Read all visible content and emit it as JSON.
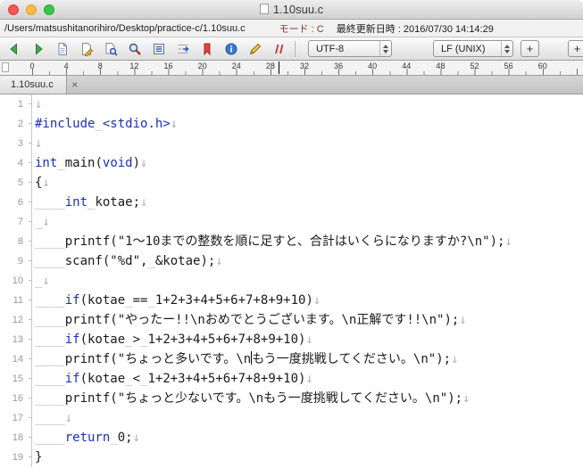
{
  "window": {
    "title": "1.10suu.c"
  },
  "info_bar": {
    "path": "/Users/matsushitanorihiro/Desktop/practice-c/1.10suu.c",
    "mode": "モード : C",
    "last_modified": "最終更新日時 : 2016/07/30 14:14:29"
  },
  "toolbar": {
    "icons": [
      "back",
      "forward",
      "new-document",
      "edit-document",
      "document-search",
      "search",
      "document-list",
      "goto-line",
      "bookmark",
      "info",
      "pencil",
      "comment"
    ],
    "encoding": "UTF-8",
    "line_ending": "LF (UNIX)",
    "add_label": "+"
  },
  "ruler": {
    "numbers": [
      0,
      4,
      8,
      12,
      16,
      20,
      24,
      28,
      32,
      36,
      40,
      44,
      48,
      52,
      56,
      60
    ]
  },
  "tab": {
    "label": "1.10suu.c",
    "close": "×"
  },
  "editor": {
    "lines": [
      {
        "no": 1,
        "segments": [
          {
            "t": "eol",
            "v": "↓"
          }
        ]
      },
      {
        "no": 2,
        "segments": [
          {
            "t": "kw",
            "v": "#include"
          },
          {
            "t": "sp",
            "v": "_"
          },
          {
            "t": "kw",
            "v": "<stdio.h>"
          },
          {
            "t": "eol",
            "v": "↓"
          }
        ]
      },
      {
        "no": 3,
        "segments": [
          {
            "t": "eol",
            "v": "↓"
          }
        ]
      },
      {
        "no": 4,
        "segments": [
          {
            "t": "kw",
            "v": "int"
          },
          {
            "t": "sp",
            "v": "_"
          },
          {
            "t": "pl",
            "v": "main("
          },
          {
            "t": "kw",
            "v": "void"
          },
          {
            "t": "pl",
            "v": ")"
          },
          {
            "t": "eol",
            "v": "↓"
          }
        ]
      },
      {
        "no": 5,
        "segments": [
          {
            "t": "pl",
            "v": "{"
          },
          {
            "t": "eol",
            "v": "↓"
          }
        ]
      },
      {
        "no": 6,
        "segments": [
          {
            "t": "sp",
            "v": "____"
          },
          {
            "t": "kw",
            "v": "int"
          },
          {
            "t": "sp",
            "v": "_"
          },
          {
            "t": "pl",
            "v": "kotae;"
          },
          {
            "t": "eol",
            "v": "↓"
          }
        ]
      },
      {
        "no": 7,
        "segments": [
          {
            "t": "sp",
            "v": "_"
          },
          {
            "t": "eol",
            "v": "↓"
          }
        ]
      },
      {
        "no": 8,
        "segments": [
          {
            "t": "sp",
            "v": "____"
          },
          {
            "t": "pl",
            "v": "printf(\"1〜10までの整数を順に足すと、合計はいくらになりますか?\\n\");"
          },
          {
            "t": "eol",
            "v": "↓"
          }
        ]
      },
      {
        "no": 9,
        "segments": [
          {
            "t": "sp",
            "v": "____"
          },
          {
            "t": "pl",
            "v": "scanf(\"%d\","
          },
          {
            "t": "sp",
            "v": "_"
          },
          {
            "t": "pl",
            "v": "&kotae);"
          },
          {
            "t": "eol",
            "v": "↓"
          }
        ]
      },
      {
        "no": 10,
        "segments": [
          {
            "t": "sp",
            "v": "_"
          },
          {
            "t": "eol",
            "v": "↓"
          }
        ]
      },
      {
        "no": 11,
        "segments": [
          {
            "t": "sp",
            "v": "____"
          },
          {
            "t": "kw",
            "v": "if"
          },
          {
            "t": "pl",
            "v": "(kotae"
          },
          {
            "t": "sp",
            "v": "_"
          },
          {
            "t": "pl",
            "v": "=="
          },
          {
            "t": "sp",
            "v": "_"
          },
          {
            "t": "pl",
            "v": "1+2+3+4+5+6+7+8+9+10)"
          },
          {
            "t": "eol",
            "v": "↓"
          }
        ]
      },
      {
        "no": 12,
        "segments": [
          {
            "t": "sp",
            "v": "____"
          },
          {
            "t": "pl",
            "v": "printf(\"やったー!!\\nおめでとうございます。\\n正解です!!\\n\");"
          },
          {
            "t": "eol",
            "v": "↓"
          }
        ]
      },
      {
        "no": 13,
        "segments": [
          {
            "t": "sp",
            "v": "____"
          },
          {
            "t": "kw",
            "v": "if"
          },
          {
            "t": "pl",
            "v": "(kotae"
          },
          {
            "t": "sp",
            "v": "_"
          },
          {
            "t": "pl",
            "v": ">"
          },
          {
            "t": "sp",
            "v": "_"
          },
          {
            "t": "pl",
            "v": "1+2+3+4+5+6+7+8+9+10)"
          },
          {
            "t": "eol",
            "v": "↓"
          }
        ]
      },
      {
        "no": 14,
        "segments": [
          {
            "t": "sp",
            "v": "____"
          },
          {
            "t": "pl",
            "v": "printf(\"ちょっと多いです。\\n"
          },
          {
            "t": "caret"
          },
          {
            "t": "pl",
            "v": "もう一度挑戦してください。\\n\");"
          },
          {
            "t": "eol",
            "v": "↓"
          }
        ]
      },
      {
        "no": 15,
        "segments": [
          {
            "t": "sp",
            "v": "____"
          },
          {
            "t": "kw",
            "v": "if"
          },
          {
            "t": "pl",
            "v": "(kotae"
          },
          {
            "t": "sp",
            "v": "_"
          },
          {
            "t": "pl",
            "v": "<"
          },
          {
            "t": "sp",
            "v": "_"
          },
          {
            "t": "pl",
            "v": "1+2+3+4+5+6+7+8+9+10)"
          },
          {
            "t": "eol",
            "v": "↓"
          }
        ]
      },
      {
        "no": 16,
        "segments": [
          {
            "t": "sp",
            "v": "____"
          },
          {
            "t": "pl",
            "v": "printf(\"ちょっと少ないです。\\nもう一度挑戦してください。\\n\");"
          },
          {
            "t": "eol",
            "v": "↓"
          }
        ]
      },
      {
        "no": 17,
        "segments": [
          {
            "t": "sp",
            "v": "____"
          },
          {
            "t": "eol",
            "v": "↓"
          }
        ]
      },
      {
        "no": 18,
        "segments": [
          {
            "t": "sp",
            "v": "____"
          },
          {
            "t": "kw",
            "v": "return"
          },
          {
            "t": "sp",
            "v": "_"
          },
          {
            "t": "pl",
            "v": "0;"
          },
          {
            "t": "eol",
            "v": "↓"
          }
        ]
      },
      {
        "no": 19,
        "segments": [
          {
            "t": "pl",
            "v": "}"
          }
        ]
      }
    ]
  },
  "colors": {
    "keyword": "#1c2fb5",
    "text": "#1a1a1a",
    "invisible_marks": "#a9b2c6",
    "line_numbers": "#9a9a9a",
    "mode_text": "#8f3333",
    "caret": "#000000"
  }
}
